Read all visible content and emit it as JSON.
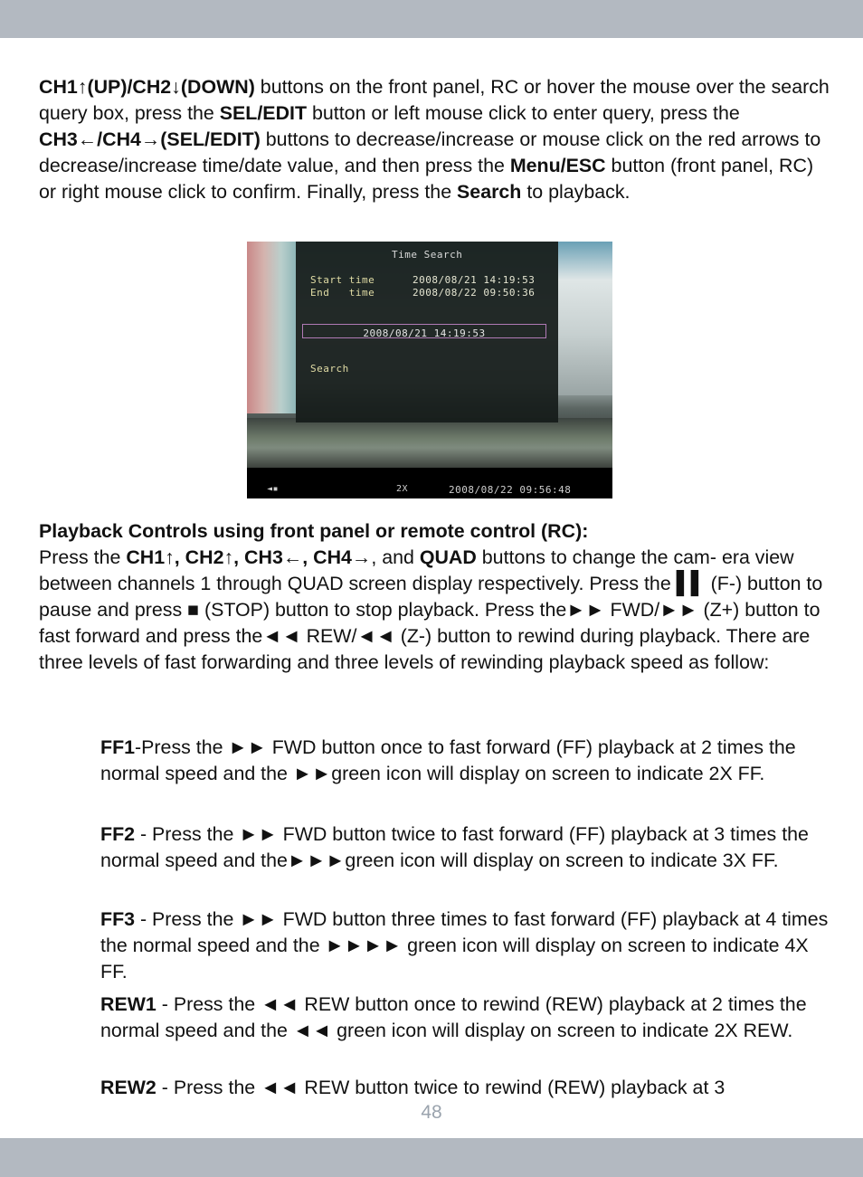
{
  "page": {
    "number": "48",
    "header_bar_color": "#b3b9c1",
    "page_number_color": "#9aa3ad"
  },
  "intro": {
    "b1": "CH1↑(UP)/CH2↓(DOWN)",
    "t1": " buttons on the front panel, RC or hover the mouse over the search query box, press the ",
    "b2": "SEL/EDIT",
    "t2": " button or left mouse click to enter query, press the ",
    "b3": "CH3←/CH4→(SEL/EDIT)",
    "t3": " buttons to decrease/increase or mouse click on the red arrows to decrease/increase time/date value, and then press the ",
    "b4": "Menu/ESC",
    "t4": " button (front panel, RC) or right mouse click to confirm. Finally, press the ",
    "b5": "Search",
    "t5": " to playback."
  },
  "screenshot": {
    "title": "Time Search",
    "start_label": "Start time",
    "start_value": "2008/08/21 14:19:53",
    "end_label": "End   time",
    "end_value": "2008/08/22 09:50:36",
    "query_value": "2008/08/21 14:19:53",
    "search_label": "Search",
    "status_icon": "◄▪",
    "status_speed": "2X",
    "status_time": "2008/08/22 09:56:48",
    "query_border_color": "#b07ab5"
  },
  "playback": {
    "heading": "Playback Controls using front panel or remote control (RC):",
    "t1": "Press the ",
    "b1": "CH1↑, CH2↑, CH3←, CH4→",
    "t2": ", and ",
    "b2": "QUAD",
    "t3": " buttons to change the cam- era view between channels 1 through QUAD screen display respectively.  Press the ",
    "pause_glyph": "▌▌",
    "t4": " (F-) button to pause and press ■ (STOP) button to stop playback.    Press the►► FWD/►► (Z+) button to fast forward and press the◄◄ REW/◄◄ (Z-) button to rewind during playback.  There are three levels of fast forwarding and three levels of rewinding playback speed as follow:"
  },
  "speed_levels": [
    {
      "label": "FF1",
      "text": "-Press the ►► FWD button once to fast forward (FF) playback at 2 times the normal speed and the ►►green icon will display on screen to indicate 2X FF."
    },
    {
      "label": "FF2",
      "text": " - Press the ►► FWD button twice to fast forward (FF) playback at 3 times the normal speed and the►►►green icon will display on screen to indicate 3X FF."
    },
    {
      "label": "FF3",
      "text": " - Press the ►► FWD button three times to fast forward (FF) playback at 4 times the normal speed and the ►►►► green icon will display on screen to indicate 4X FF."
    },
    {
      "label": "REW1",
      "text": " - Press the ◄◄ REW button once to rewind (REW) playback at 2 times the normal speed and the ◄◄ green icon will display on screen to indicate 2X REW."
    },
    {
      "label": "REW2",
      "text": " - Press the ◄◄ REW button twice to rewind (REW) playback at 3"
    }
  ]
}
